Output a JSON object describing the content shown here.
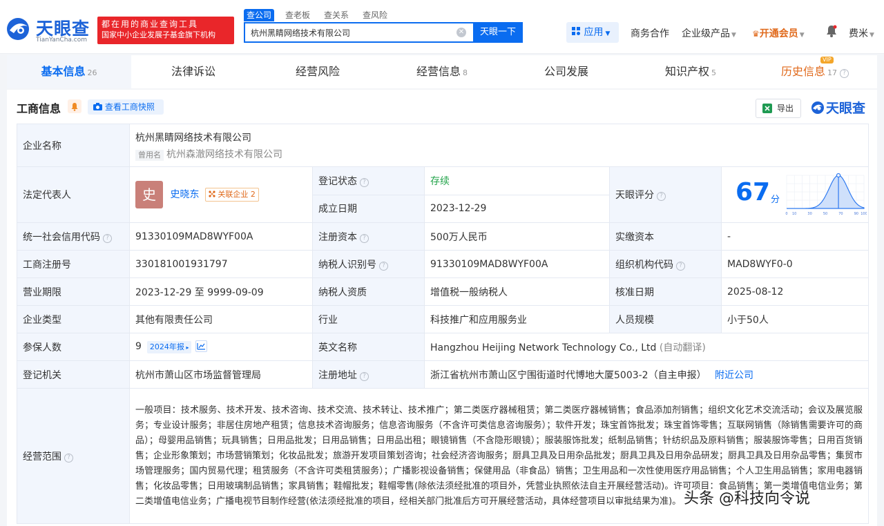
{
  "logo": {
    "name": "天眼查",
    "domain": "TianYanCha.com"
  },
  "slogan": {
    "line1": "都在用的商业查询工具",
    "line2": "国家中小企业发展子基金旗下机构"
  },
  "search": {
    "tabs": [
      "查公司",
      "查老板",
      "查关系",
      "查风险"
    ],
    "value": "杭州黑睛网络技术有限公司",
    "button": "天眼一下"
  },
  "topnav": {
    "app": "应用",
    "business": "商务合作",
    "enterprise": "企业级产品",
    "vip": "开通会员",
    "user": "费米"
  },
  "tabs": [
    {
      "label": "基本信息",
      "count": "26"
    },
    {
      "label": "法律诉讼",
      "count": ""
    },
    {
      "label": "经营风险",
      "count": ""
    },
    {
      "label": "经营信息",
      "count": "8"
    },
    {
      "label": "公司发展",
      "count": ""
    },
    {
      "label": "知识产权",
      "count": "5"
    },
    {
      "label": "历史信息",
      "count": "17",
      "badge": "VIP"
    }
  ],
  "section": {
    "title": "工商信息",
    "snapshot": "查看工商快照",
    "export": "导出",
    "brand": "天眼查"
  },
  "info": {
    "name_label": "企业名称",
    "name": "杭州黑睛网络技术有限公司",
    "former_tag": "曾用名",
    "former_name": "杭州森澈网络技术有限公司",
    "legal_label": "法定代表人",
    "legal_avatar": "史",
    "legal_name": "史晓东",
    "legal_related": "关联企业 2",
    "status_label": "登记状态",
    "status": "存续",
    "found_label": "成立日期",
    "found_date": "2023-12-29",
    "score_label": "天眼评分",
    "score": 67,
    "score_unit": "分",
    "score_ticks": [
      "0",
      "10",
      "30",
      "50",
      "70",
      "90",
      "100"
    ],
    "credit_label": "统一社会信用代码",
    "credit_code": "91330109MAD8WYF00A",
    "capital_label": "注册资本",
    "capital": "500万人民币",
    "paid_label": "实缴资本",
    "paid": "-",
    "reg_label": "工商注册号",
    "reg_no": "330181001931797",
    "tax_label": "纳税人识别号",
    "tax_no": "91330109MAD8WYF00A",
    "org_label": "组织机构代码",
    "org_code": "MAD8WYF0-0",
    "term_label": "营业期限",
    "term": "2023-12-29 至 9999-09-09",
    "taxq_label": "纳税人资质",
    "taxq": "增值税一般纳税人",
    "approve_label": "核准日期",
    "approve_date": "2025-08-12",
    "type_label": "企业类型",
    "type": "其他有限责任公司",
    "industry_label": "行业",
    "industry": "科技推广和应用服务业",
    "staff_label": "人员规模",
    "staff": "小于50人",
    "insured_label": "参保人数",
    "insured": "9",
    "insured_year": "2024年报",
    "en_label": "英文名称",
    "en_name": "Hangzhou Heijing Network Technology Co., Ltd",
    "en_note": "(自动翻译)",
    "authority_label": "登记机关",
    "authority": "杭州市萧山区市场监督管理局",
    "address_label": "注册地址",
    "address": "浙江省杭州市萧山区宁围街道时代博地大厦5003-2（自主申报）",
    "nearby": "附近公司",
    "scope_label": "经营范围",
    "scope": "一般项目：技术服务、技术开发、技术咨询、技术交流、技术转让、技术推广；第二类医疗器械租赁；第二类医疗器械销售；食品添加剂销售；组织文化艺术交流活动；会议及展览服务；专业设计服务；非居住房地产租赁；信息技术咨询服务；信息咨询服务（不含许可类信息咨询服务）；软件开发；珠宝首饰批发；珠宝首饰零售；互联网销售（除销售需要许可的商品）；母婴用品销售；玩具销售；日用品批发；日用品销售；日用品出租；眼镜销售（不含隐形眼镜）；服装服饰批发；纸制品销售；针纺织品及原料销售；服装服饰零售；日用百货销售；企业形象策划；市场营销策划；化妆品批发；旅游开发项目策划咨询；社会经济咨询服务；厨具卫具及日用杂品批发；厨具卫具及日用杂品研发；厨具卫具及日用杂品零售；集贸市场管理服务；国内贸易代理；租赁服务（不含许可类租赁服务）；广播影视设备销售；保健用品（非食品）销售；卫生用品和一次性使用医疗用品销售；个人卫生用品销售；家用电器销售；化妆品零售；日用玻璃制品销售；家具销售；鞋帽批发；鞋帽零售(除依法须经批准的项目外，凭营业执照依法自主开展经营活动)。许可项目：食品销售；第一类增值电信业务；第二类增值电信业务；广播电视节目制作经营(依法须经批准的项目，经相关部门批准后方可开展经营活动，具体经营项目以审批结果为准)。"
  },
  "watermark": "头条 @科技向令说",
  "colors": {
    "accent": "#0a6cf0",
    "vip": "#e0691b",
    "status": "#22a34a",
    "slogan": "#e9262a"
  }
}
